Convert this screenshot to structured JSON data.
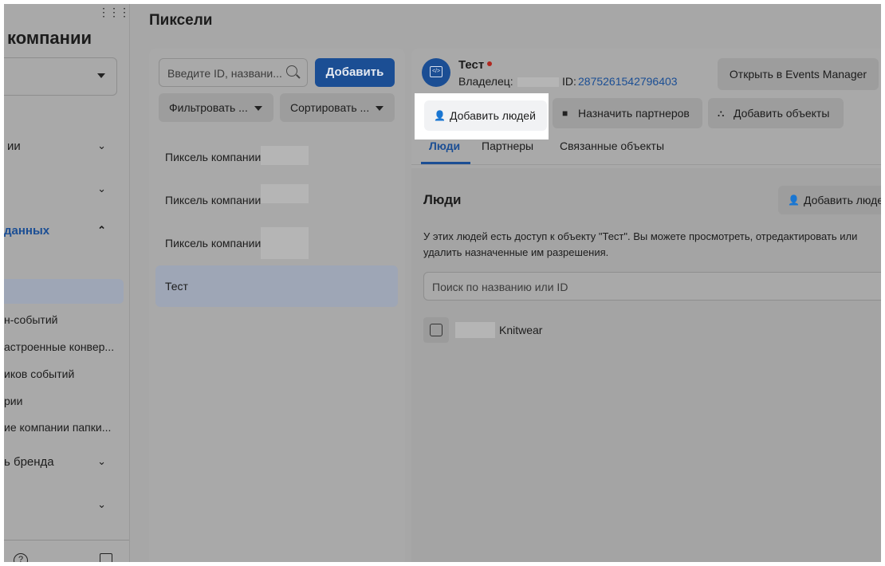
{
  "sidebar": {
    "title": "компании",
    "items": [
      {
        "label": "ии",
        "chevron": "⌄"
      },
      {
        "label": "",
        "chevron": "⌄"
      },
      {
        "label": "данных",
        "chevron": "⌃"
      },
      {
        "label": "н-событий"
      },
      {
        "label": "астроенные конвер..."
      },
      {
        "label": "иков событий"
      },
      {
        "label": "рии"
      },
      {
        "label": "ие компании папки..."
      },
      {
        "label": "ь бренда",
        "chevron": "⌄"
      },
      {
        "label": "",
        "chevron": "⌄"
      }
    ]
  },
  "header": {
    "title": "Пиксели"
  },
  "list": {
    "search_placeholder": "Введите ID, названи...",
    "add_label": "Добавить",
    "filter_label": "Фильтровать ...",
    "sort_label": "Сортировать ...",
    "pixels": [
      {
        "name": "Пиксель компании"
      },
      {
        "name": "Пиксель компании"
      },
      {
        "name": "Пиксель компании"
      },
      {
        "name": "Тест"
      }
    ]
  },
  "detail": {
    "name": "Тест",
    "owner_label": "Владелец:",
    "id_label": "ID:",
    "id_value": "2875261542796403",
    "open_events_label": "Открыть в Events Manager",
    "actions": {
      "add_people": "Добавить людей",
      "assign_partners": "Назначить партнеров",
      "add_objects": "Добавить объекты"
    },
    "tabs": [
      "Люди",
      "Партнеры",
      "Связанные объекты"
    ],
    "people": {
      "title": "Люди",
      "add_people_button": "Добавить люде",
      "description": "У этих людей есть доступ к объекту \"Тест\". Вы можете просмотреть, отредактировать или удалить назначенные им разрешения.",
      "search_placeholder": "Поиск по названию или ID",
      "members": [
        {
          "name": "Knitwear"
        }
      ]
    }
  },
  "colors": {
    "accent": "#1b4e94",
    "overlay": "#a7a7a7",
    "status_dot": "#b0271f"
  }
}
